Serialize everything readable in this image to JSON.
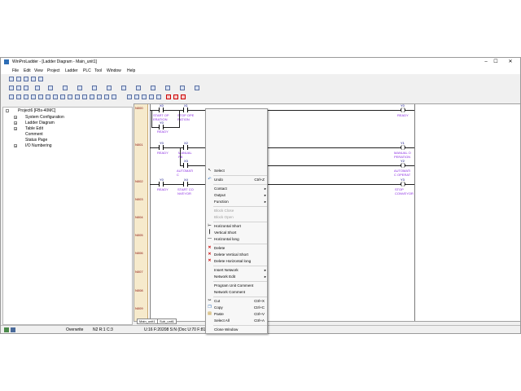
{
  "window": {
    "title": "WinProLadder - [Ladder Diagram - Main_unit1]",
    "minimize": "–",
    "maximize": "☐",
    "close": "✕"
  },
  "menu": [
    "File",
    "Edit",
    "View",
    "Project",
    "Ladder",
    "PLC",
    "Tool",
    "Window",
    "Help"
  ],
  "tree": {
    "root": "Project6 [FBs-40MC]",
    "items": [
      "System Configuration",
      "Ladder Diagram",
      "Table Edit",
      "Comment",
      "Status Page",
      "I/O Numbering"
    ]
  },
  "ladder": {
    "networks": [
      "N000",
      "N001",
      "N002",
      "N003",
      "N004",
      "N005",
      "N006",
      "N007",
      "N008",
      "N009"
    ],
    "n000": {
      "c1_addr": "X0",
      "c1_cmt": "START OP\nERATION",
      "c2_addr": "X1",
      "c2_cmt": "STOP OPE\nRATION",
      "c3_addr": "Y0",
      "c3_cmt": "READY",
      "coil_addr": "Y0",
      "coil_cmt": "READY"
    },
    "n001": {
      "c1_addr": "Y0",
      "c1_cmt": "READY",
      "c2_addr": "X2",
      "c2_cmt": "MANUAL\nPB",
      "c3_addr": "X3",
      "c3_cmt": "AUTOMATI\nC",
      "coil1_addr": "Y1",
      "coil1_cmt": "MANUAL O\nPERATION",
      "coil2_addr": "Y2",
      "coil2_cmt": "AUTOMATI\nC OPERAT"
    },
    "n002": {
      "c1_addr": "Y0",
      "c1_cmt": "READY",
      "c2_addr": "X4",
      "c2_cmt": "START CO\nNVEYOR",
      "coil_addr": "Y3",
      "coil_cmt": "STOP\nCONVEYOR"
    }
  },
  "tabs": [
    "Main_unit1",
    "Sub_unit1"
  ],
  "status": {
    "mode": "Overwrite",
    "pos": "N2 R:1 C:3",
    "info": "U:16 F:20208 S:N (Doc U:70 F:8121)"
  },
  "context_menu": {
    "items": [
      {
        "label": "Select",
        "shortcut": "",
        "icon": "pointer"
      },
      {
        "label": "Undo",
        "shortcut": "Ctrl+Z",
        "icon": "undo"
      },
      {
        "label": "Contact",
        "shortcut": "",
        "sub": true
      },
      {
        "label": "Output",
        "shortcut": "",
        "sub": true
      },
      {
        "label": "Function",
        "shortcut": "",
        "sub": true
      },
      {
        "label": "Block Close",
        "shortcut": "",
        "disabled": true
      },
      {
        "label": "Block Open",
        "shortcut": "",
        "disabled": true
      },
      {
        "label": "Horizontal Short",
        "shortcut": "",
        "icon": "hshort"
      },
      {
        "label": "Vertical Short",
        "shortcut": "",
        "icon": "vshort"
      },
      {
        "label": "Horizontal long",
        "shortcut": "",
        "icon": "hlong"
      },
      {
        "label": "Delete",
        "shortcut": "",
        "icon": "delete"
      },
      {
        "label": "Delete Vertical Short",
        "shortcut": "",
        "icon": "delete"
      },
      {
        "label": "Delete Horizontal long",
        "shortcut": "",
        "icon": "delete"
      },
      {
        "label": "Insert Network",
        "shortcut": "",
        "sub": true
      },
      {
        "label": "Network Edit",
        "shortcut": "",
        "sub": true
      },
      {
        "label": "Program Unit Comment",
        "shortcut": ""
      },
      {
        "label": "Network Comment",
        "shortcut": ""
      },
      {
        "label": "Cut",
        "shortcut": "Ctrl+X",
        "icon": "cut"
      },
      {
        "label": "Copy",
        "shortcut": "Ctrl+C",
        "icon": "copy"
      },
      {
        "label": "Paste",
        "shortcut": "Ctrl+V",
        "icon": "paste"
      },
      {
        "label": "Select All",
        "shortcut": "Ctrl+A"
      },
      {
        "label": "Close Window",
        "shortcut": ""
      }
    ]
  },
  "colors": {
    "network_col": "#f6eacc",
    "address": "#000080",
    "comment": "#8a2be2",
    "delete_icon": "#cc0000"
  }
}
